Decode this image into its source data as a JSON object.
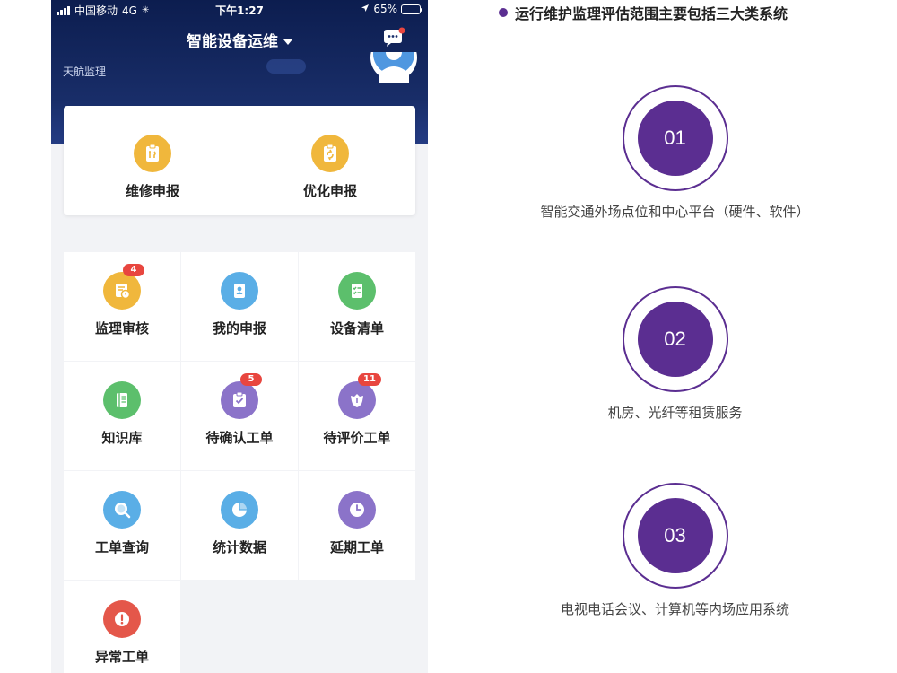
{
  "statusbar": {
    "carrier": "中国移动",
    "network": "4G",
    "time": "下午1:27",
    "battery": "65%"
  },
  "header": {
    "title": "智能设备运维",
    "org": "天航监理"
  },
  "quick_actions": [
    {
      "label": "维修申报",
      "icon": "repair-clipboard-icon",
      "color": "#f0b73c"
    },
    {
      "label": "优化申报",
      "icon": "optimize-clipboard-icon",
      "color": "#f0b73c"
    }
  ],
  "menu": [
    {
      "label": "监理审核",
      "icon": "review-document-icon",
      "color": "#f0b73c",
      "badge": "4"
    },
    {
      "label": "我的申报",
      "icon": "user-badge-icon",
      "color": "#5aaee6",
      "badge": ""
    },
    {
      "label": "设备清单",
      "icon": "checklist-icon",
      "color": "#5cbf6c",
      "badge": ""
    },
    {
      "label": "知识库",
      "icon": "book-icon",
      "color": "#5cbf6c",
      "badge": ""
    },
    {
      "label": "待确认工单",
      "icon": "clipboard-check-icon",
      "color": "#8b73c9",
      "badge": "5"
    },
    {
      "label": "待评价工单",
      "icon": "rate-shield-icon",
      "color": "#8b73c9",
      "badge": "11"
    },
    {
      "label": "工单查询",
      "icon": "search-icon",
      "color": "#5aaee6",
      "badge": ""
    },
    {
      "label": "统计数据",
      "icon": "pie-chart-icon",
      "color": "#5aaee6",
      "badge": ""
    },
    {
      "label": "延期工单",
      "icon": "clock-icon",
      "color": "#8b73c9",
      "badge": ""
    },
    {
      "label": "异常工单",
      "icon": "alert-icon",
      "color": "#e4574a",
      "badge": ""
    }
  ],
  "panel": {
    "title": "运行维护监理评估范围主要包括三大类系统",
    "accent": "#5b2e91",
    "steps": [
      {
        "num": "01",
        "desc": "智能交通外场点位和中心平台（硬件、软件）"
      },
      {
        "num": "02",
        "desc": "机房、光纤等租赁服务"
      },
      {
        "num": "03",
        "desc": "电视电话会议、计算机等内场应用系统"
      }
    ]
  }
}
